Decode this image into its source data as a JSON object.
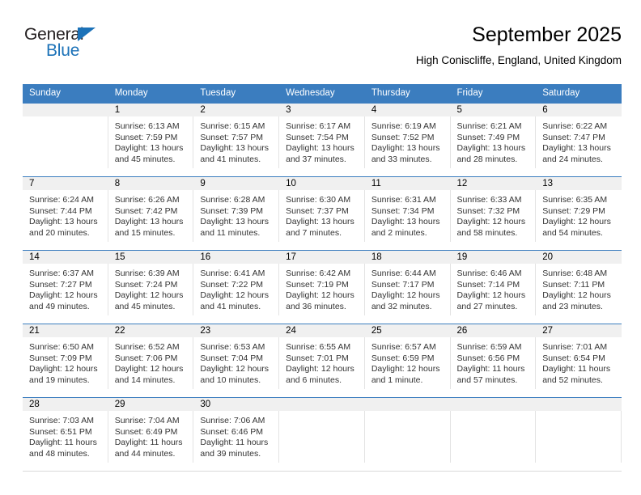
{
  "brand": {
    "name_part1": "General",
    "name_part2": "Blue",
    "triangle_color": "#1c72b8"
  },
  "header": {
    "title": "September 2025",
    "subtitle": "High Coniscliffe, England, United Kingdom"
  },
  "theme": {
    "header_bg": "#3b7dbf",
    "daynum_band": "#f0f0f0",
    "grid_line": "#e3e3e3",
    "text": "#333333"
  },
  "weekday_headers": [
    "Sunday",
    "Monday",
    "Tuesday",
    "Wednesday",
    "Thursday",
    "Friday",
    "Saturday"
  ],
  "weeks": [
    [
      {
        "day": "",
        "lines": []
      },
      {
        "day": "1",
        "lines": [
          "Sunrise: 6:13 AM",
          "Sunset: 7:59 PM",
          "Daylight: 13 hours",
          "and 45 minutes."
        ]
      },
      {
        "day": "2",
        "lines": [
          "Sunrise: 6:15 AM",
          "Sunset: 7:57 PM",
          "Daylight: 13 hours",
          "and 41 minutes."
        ]
      },
      {
        "day": "3",
        "lines": [
          "Sunrise: 6:17 AM",
          "Sunset: 7:54 PM",
          "Daylight: 13 hours",
          "and 37 minutes."
        ]
      },
      {
        "day": "4",
        "lines": [
          "Sunrise: 6:19 AM",
          "Sunset: 7:52 PM",
          "Daylight: 13 hours",
          "and 33 minutes."
        ]
      },
      {
        "day": "5",
        "lines": [
          "Sunrise: 6:21 AM",
          "Sunset: 7:49 PM",
          "Daylight: 13 hours",
          "and 28 minutes."
        ]
      },
      {
        "day": "6",
        "lines": [
          "Sunrise: 6:22 AM",
          "Sunset: 7:47 PM",
          "Daylight: 13 hours",
          "and 24 minutes."
        ]
      }
    ],
    [
      {
        "day": "7",
        "lines": [
          "Sunrise: 6:24 AM",
          "Sunset: 7:44 PM",
          "Daylight: 13 hours",
          "and 20 minutes."
        ]
      },
      {
        "day": "8",
        "lines": [
          "Sunrise: 6:26 AM",
          "Sunset: 7:42 PM",
          "Daylight: 13 hours",
          "and 15 minutes."
        ]
      },
      {
        "day": "9",
        "lines": [
          "Sunrise: 6:28 AM",
          "Sunset: 7:39 PM",
          "Daylight: 13 hours",
          "and 11 minutes."
        ]
      },
      {
        "day": "10",
        "lines": [
          "Sunrise: 6:30 AM",
          "Sunset: 7:37 PM",
          "Daylight: 13 hours",
          "and 7 minutes."
        ]
      },
      {
        "day": "11",
        "lines": [
          "Sunrise: 6:31 AM",
          "Sunset: 7:34 PM",
          "Daylight: 13 hours",
          "and 2 minutes."
        ]
      },
      {
        "day": "12",
        "lines": [
          "Sunrise: 6:33 AM",
          "Sunset: 7:32 PM",
          "Daylight: 12 hours",
          "and 58 minutes."
        ]
      },
      {
        "day": "13",
        "lines": [
          "Sunrise: 6:35 AM",
          "Sunset: 7:29 PM",
          "Daylight: 12 hours",
          "and 54 minutes."
        ]
      }
    ],
    [
      {
        "day": "14",
        "lines": [
          "Sunrise: 6:37 AM",
          "Sunset: 7:27 PM",
          "Daylight: 12 hours",
          "and 49 minutes."
        ]
      },
      {
        "day": "15",
        "lines": [
          "Sunrise: 6:39 AM",
          "Sunset: 7:24 PM",
          "Daylight: 12 hours",
          "and 45 minutes."
        ]
      },
      {
        "day": "16",
        "lines": [
          "Sunrise: 6:41 AM",
          "Sunset: 7:22 PM",
          "Daylight: 12 hours",
          "and 41 minutes."
        ]
      },
      {
        "day": "17",
        "lines": [
          "Sunrise: 6:42 AM",
          "Sunset: 7:19 PM",
          "Daylight: 12 hours",
          "and 36 minutes."
        ]
      },
      {
        "day": "18",
        "lines": [
          "Sunrise: 6:44 AM",
          "Sunset: 7:17 PM",
          "Daylight: 12 hours",
          "and 32 minutes."
        ]
      },
      {
        "day": "19",
        "lines": [
          "Sunrise: 6:46 AM",
          "Sunset: 7:14 PM",
          "Daylight: 12 hours",
          "and 27 minutes."
        ]
      },
      {
        "day": "20",
        "lines": [
          "Sunrise: 6:48 AM",
          "Sunset: 7:11 PM",
          "Daylight: 12 hours",
          "and 23 minutes."
        ]
      }
    ],
    [
      {
        "day": "21",
        "lines": [
          "Sunrise: 6:50 AM",
          "Sunset: 7:09 PM",
          "Daylight: 12 hours",
          "and 19 minutes."
        ]
      },
      {
        "day": "22",
        "lines": [
          "Sunrise: 6:52 AM",
          "Sunset: 7:06 PM",
          "Daylight: 12 hours",
          "and 14 minutes."
        ]
      },
      {
        "day": "23",
        "lines": [
          "Sunrise: 6:53 AM",
          "Sunset: 7:04 PM",
          "Daylight: 12 hours",
          "and 10 minutes."
        ]
      },
      {
        "day": "24",
        "lines": [
          "Sunrise: 6:55 AM",
          "Sunset: 7:01 PM",
          "Daylight: 12 hours",
          "and 6 minutes."
        ]
      },
      {
        "day": "25",
        "lines": [
          "Sunrise: 6:57 AM",
          "Sunset: 6:59 PM",
          "Daylight: 12 hours",
          "and 1 minute."
        ]
      },
      {
        "day": "26",
        "lines": [
          "Sunrise: 6:59 AM",
          "Sunset: 6:56 PM",
          "Daylight: 11 hours",
          "and 57 minutes."
        ]
      },
      {
        "day": "27",
        "lines": [
          "Sunrise: 7:01 AM",
          "Sunset: 6:54 PM",
          "Daylight: 11 hours",
          "and 52 minutes."
        ]
      }
    ],
    [
      {
        "day": "28",
        "lines": [
          "Sunrise: 7:03 AM",
          "Sunset: 6:51 PM",
          "Daylight: 11 hours",
          "and 48 minutes."
        ]
      },
      {
        "day": "29",
        "lines": [
          "Sunrise: 7:04 AM",
          "Sunset: 6:49 PM",
          "Daylight: 11 hours",
          "and 44 minutes."
        ]
      },
      {
        "day": "30",
        "lines": [
          "Sunrise: 7:06 AM",
          "Sunset: 6:46 PM",
          "Daylight: 11 hours",
          "and 39 minutes."
        ]
      },
      {
        "day": "",
        "lines": []
      },
      {
        "day": "",
        "lines": []
      },
      {
        "day": "",
        "lines": []
      },
      {
        "day": "",
        "lines": []
      }
    ]
  ]
}
